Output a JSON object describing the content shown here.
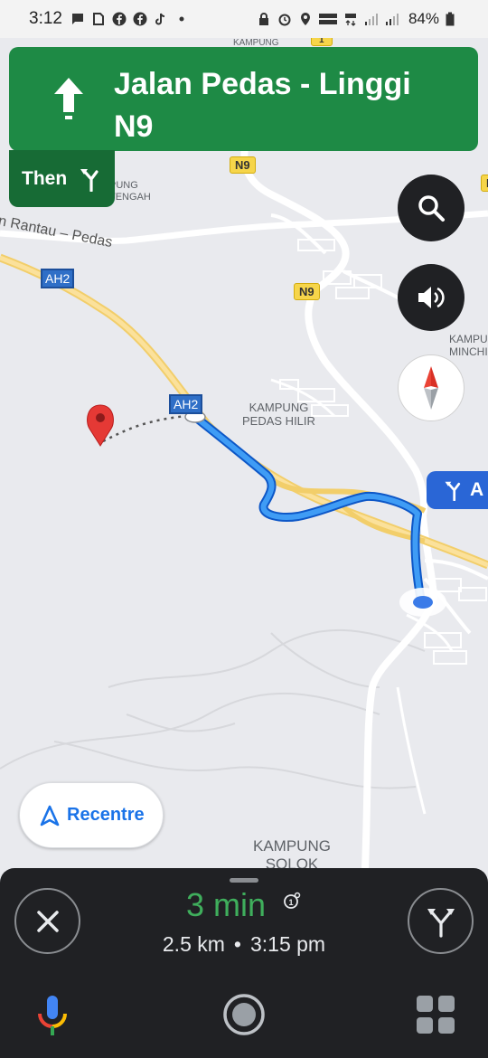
{
  "status_bar": {
    "time": "3:12",
    "battery": "84%"
  },
  "navigation": {
    "street": "Jalan Pedas - Linggi N9",
    "then_label": "Then",
    "next_turn_partial": "A"
  },
  "map": {
    "labels": {
      "kampung_top": "KAMPUNG",
      "kampung_tengah": "PUNG\nTENGAH",
      "road_rantau_pedas": "n Rantau – Pedas",
      "kampung_pedas_hilir": "KAMPUNG\nPEDAS HILIR",
      "kampung_minchi": "KAMPU\nMINCHI",
      "kampung_solok": "KAMPUNG\nSOLOK"
    },
    "shields": {
      "n9_top": "N9",
      "n9_mid": "N9",
      "ah2_left": "AH2",
      "ah2_mid": "AH2",
      "route_1": "1",
      "n_right": "N"
    }
  },
  "buttons": {
    "recentre_label": "Recentre"
  },
  "trip": {
    "duration": "3 min",
    "distance": "2.5 km",
    "separator": "•",
    "arrival_time": "3:15 pm"
  },
  "colors": {
    "nav_green": "#1e8a45",
    "then_green": "#176b35",
    "route_blue": "#1a73e8",
    "eta_green": "#3fae5c",
    "sheet_dark": "#202124"
  }
}
